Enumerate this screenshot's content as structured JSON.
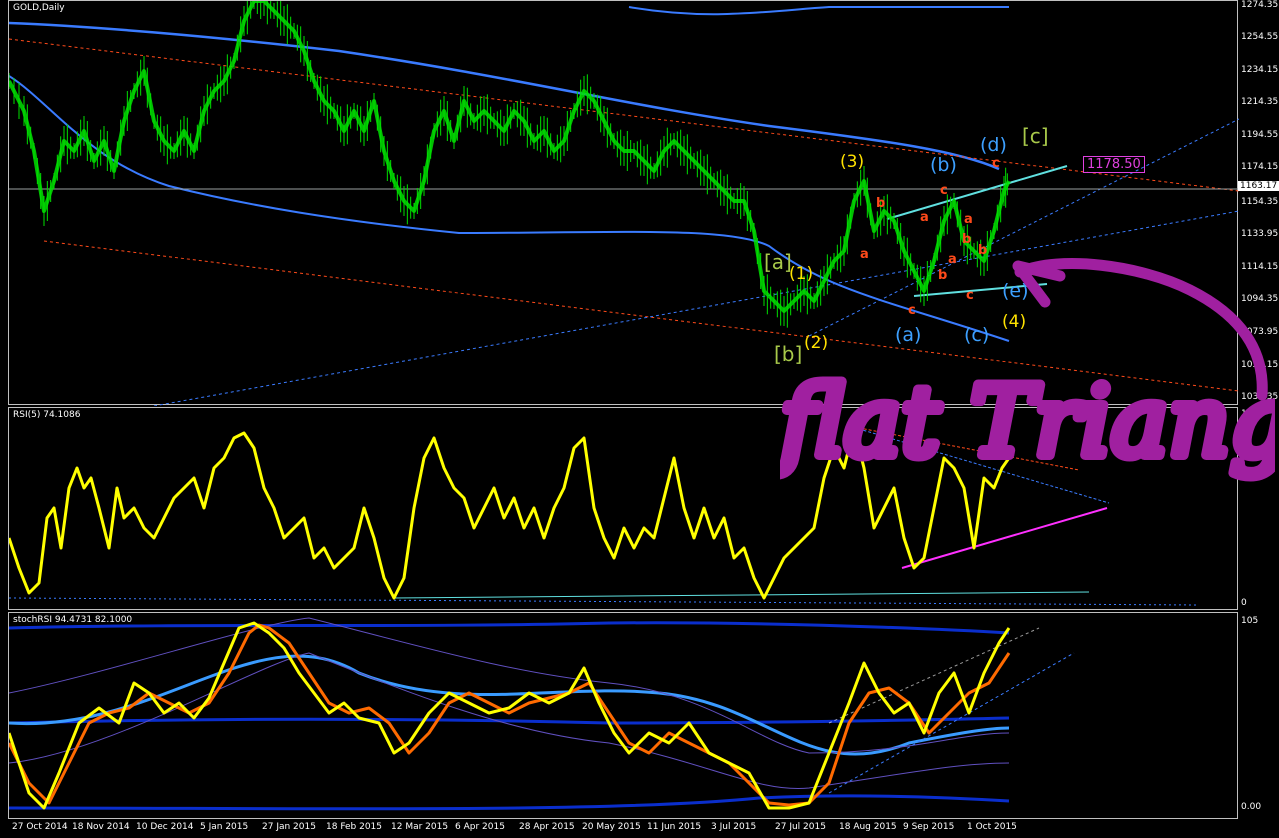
{
  "main_panel": {
    "label": "GOLD,Daily"
  },
  "rsi_panel": {
    "label": "RSI(5) 74.1086"
  },
  "stoch_panel": {
    "label": "stochRSI 94.4731 82.1000"
  },
  "price_axis": [
    {
      "label": "1274.35"
    },
    {
      "label": "1254.55"
    },
    {
      "label": "1234.15"
    },
    {
      "label": "1214.35"
    },
    {
      "label": "1194.55"
    },
    {
      "label": "1174.15"
    },
    {
      "label": "1163.17",
      "current": true
    },
    {
      "label": "1154.35"
    },
    {
      "label": "1133.95"
    },
    {
      "label": "1114.15"
    },
    {
      "label": "1094.35"
    },
    {
      "label": "1073.95"
    },
    {
      "label": "1054.15"
    },
    {
      "label": "1034.35"
    }
  ],
  "rsi_axis": [
    {
      "label": "100"
    },
    {
      "label": "0"
    }
  ],
  "stoch_axis": [
    {
      "label": "105"
    },
    {
      "label": "0.00"
    }
  ],
  "date_axis": [
    {
      "label": "27 Oct 2014"
    },
    {
      "label": "18 Nov 2014"
    },
    {
      "label": "10 Dec 2014"
    },
    {
      "label": "5 Jan 2015"
    },
    {
      "label": "27 Jan 2015"
    },
    {
      "label": "18 Feb 2015"
    },
    {
      "label": "12 Mar 2015"
    },
    {
      "label": "6 Apr 2015"
    },
    {
      "label": "28 Apr 2015"
    },
    {
      "label": "20 May 2015"
    },
    {
      "label": "11 Jun 2015"
    },
    {
      "label": "3 Jul 2015"
    },
    {
      "label": "27 Jul 2015"
    },
    {
      "label": "18 Aug 2015"
    },
    {
      "label": "9 Sep 2015"
    },
    {
      "label": "1 Oct 2015"
    }
  ],
  "wave_labels": {
    "a1": "[a]",
    "b1": "[b]",
    "c1": "[c]",
    "w1": "(1)",
    "w2": "(2)",
    "w3": "(3)",
    "w4": "(4)",
    "ta": "(a)",
    "tb": "(b)",
    "tc": "(c)",
    "td": "(d)",
    "te": "(e)",
    "s_a": "a",
    "s_b": "b",
    "s_c": "c"
  },
  "price_box": "1178.50",
  "annotation_text": "flat Triangle",
  "colors": {
    "candles": "#00e000",
    "bands": "#3a7bff",
    "rsi": "#ffff00",
    "trend_red": "#ff4a1a",
    "annotation": "#a020a0",
    "magenta": "#ff30ff",
    "cyan": "#60e0e0"
  }
}
